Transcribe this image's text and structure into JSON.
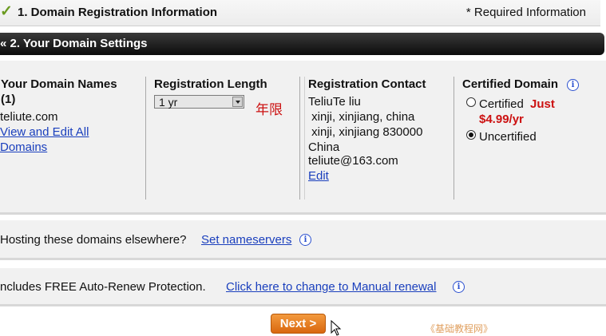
{
  "step1": {
    "check_icon": "✓",
    "title": "1. Domain Registration Information",
    "required_note": "* Required Information"
  },
  "step2": {
    "title": "« 2. Your Domain Settings"
  },
  "settings": {
    "domains": {
      "heading_line1": "Your Domain Names",
      "heading_line2": "(1)",
      "domain": "teliute.com",
      "view_edit_line1": "View and Edit All",
      "view_edit_line2": "Domains"
    },
    "length": {
      "heading": "Registration Length",
      "selected": "1 yr",
      "annotation": "年限"
    },
    "contact": {
      "heading": "Registration Contact",
      "lines": [
        "TeliuTe liu",
        " xinji, xinjiang, china",
        " xinji, xinjiang 830000",
        "China",
        "teliute@163.com"
      ],
      "edit_label": "Edit"
    },
    "certified": {
      "heading": "Certified Domain",
      "option1_label": "Certified",
      "option1_price_line1": "Just",
      "option1_price_line2": "$4.99/yr",
      "option2_label": "Uncertified",
      "selected": "Uncertified"
    }
  },
  "hosting": {
    "text": "Hosting these domains elsewhere?",
    "link": "Set nameservers"
  },
  "renew": {
    "text": "ncludes FREE Auto-Renew Protection.",
    "link": "Click here to change to Manual renewal"
  },
  "next_button": "Next >",
  "watermark": "《基础教程网》",
  "colors": {
    "accent_orange": "#e57a1f",
    "link_blue": "#1a3fbd",
    "price_red": "#cc1111",
    "header_black": "#111111"
  }
}
